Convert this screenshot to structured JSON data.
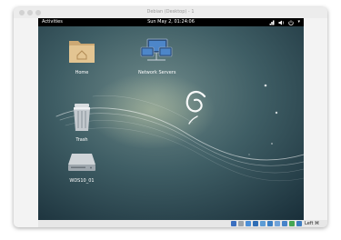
{
  "window": {
    "title": "Debian (Desktop) - 1"
  },
  "topbar": {
    "activities": "Activities",
    "clock": "Sun May  2, 01:24:06",
    "tray": {
      "network_icon": "network-icon",
      "volume_icon": "volume-icon",
      "power_icon": "power-icon",
      "menu_icon": "chevron-down-icon"
    }
  },
  "desktop": {
    "icons": [
      {
        "label": "Home",
        "icon": "folder-home-icon"
      },
      {
        "label": "Network Servers",
        "icon": "network-servers-icon"
      },
      {
        "label": "Trash",
        "icon": "trash-icon"
      },
      {
        "label": "WDS10_01",
        "icon": "drive-icon"
      }
    ]
  },
  "statusbar": {
    "host_key": "Left ⌘"
  },
  "colors": {
    "wallpaper_top": "#43636b",
    "wallpaper_bottom": "#1b3440",
    "topbar": "#000000",
    "folder": "#e1c28d"
  }
}
